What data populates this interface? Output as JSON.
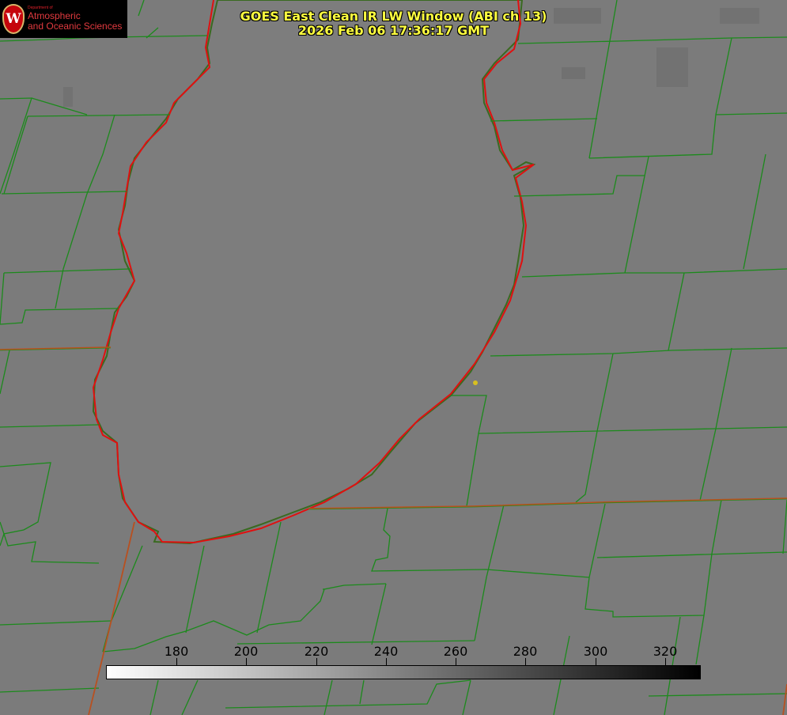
{
  "logo": {
    "department": "Department of",
    "line1": "Atmospheric",
    "line2": "and Oceanic Sciences",
    "seal_letter": "W"
  },
  "title": {
    "line1": "GOES East Clean IR LW Window (ABI ch 13)",
    "line2": "2026 Feb 06 17:36:17 GMT"
  },
  "colorbar": {
    "min": 160,
    "max": 330,
    "ticks": [
      "180",
      "200",
      "220",
      "240",
      "260",
      "280",
      "300",
      "320"
    ],
    "gradient": [
      "#ffffff",
      "#000000"
    ]
  },
  "colors": {
    "background": "#7b7b7b",
    "county_lines": "#1c8a1c",
    "state_lines": "#c05020",
    "lake_outline": "#e01010",
    "title_text": "#ffff40",
    "marker": "#d8c020"
  }
}
